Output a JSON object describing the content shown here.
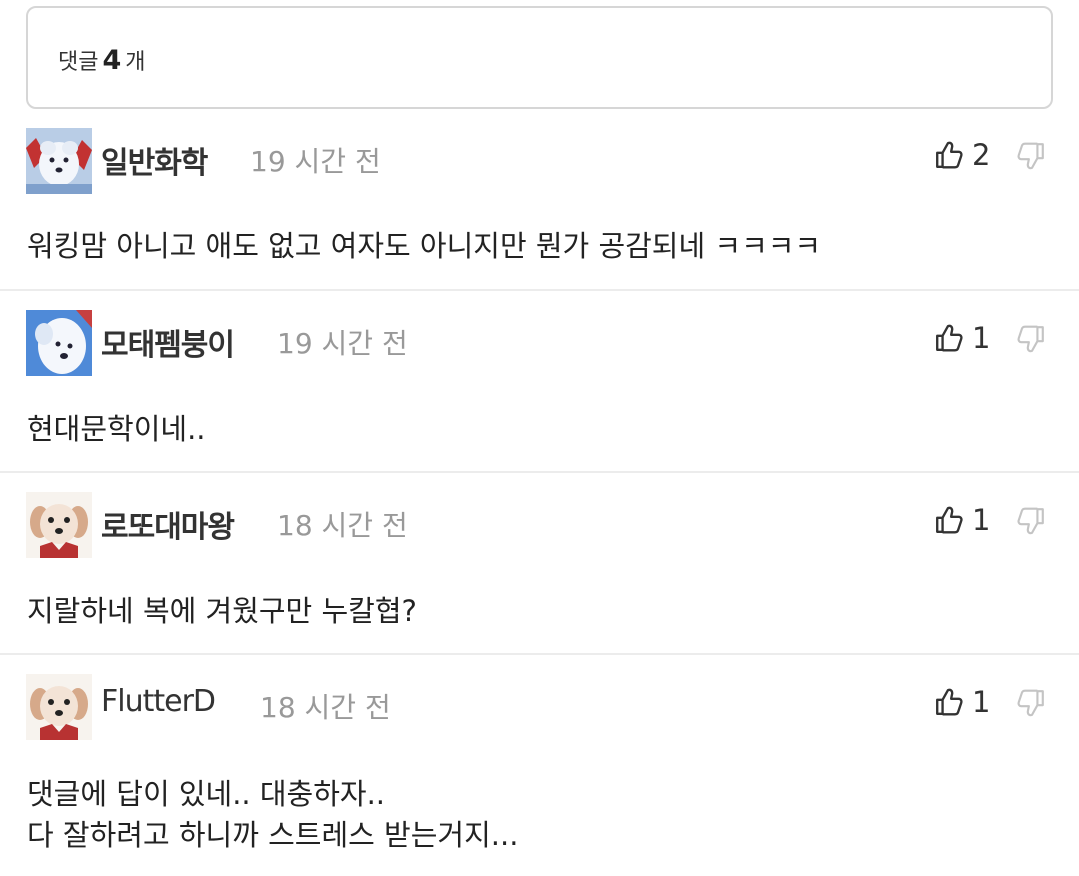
{
  "header": {
    "label_before": "댓글",
    "count": "4",
    "label_after": "개"
  },
  "comments": [
    {
      "username": "일반화학",
      "time": "19 시간 전",
      "likes": "2",
      "text": [
        "워킹맘 아니고 애도 없고 여자도 아니지만 뭔가 공감되네 ㅋㅋㅋㅋ"
      ]
    },
    {
      "username": "모태펨붕이",
      "time": "19 시간 전",
      "likes": "1",
      "text": [
        "현대문학이네.."
      ]
    },
    {
      "username": "로또대마왕",
      "time": "18 시간 전",
      "likes": "1",
      "text": [
        "지랄하네 복에 겨웠구만 누칼협?"
      ]
    },
    {
      "username": "FlutterD",
      "time": "18 시간 전",
      "likes": "1",
      "text": [
        "댓글에 답이 있네.. 대충하자..",
        "다 잘하려고 하니까 스트레스 받는거지..."
      ]
    }
  ],
  "icons": {
    "like": "thumbs-up-icon",
    "dislike": "thumbs-down-icon"
  },
  "colors": {
    "time": "#999999",
    "divider": "#ececec",
    "border": "#d6d6d6"
  }
}
